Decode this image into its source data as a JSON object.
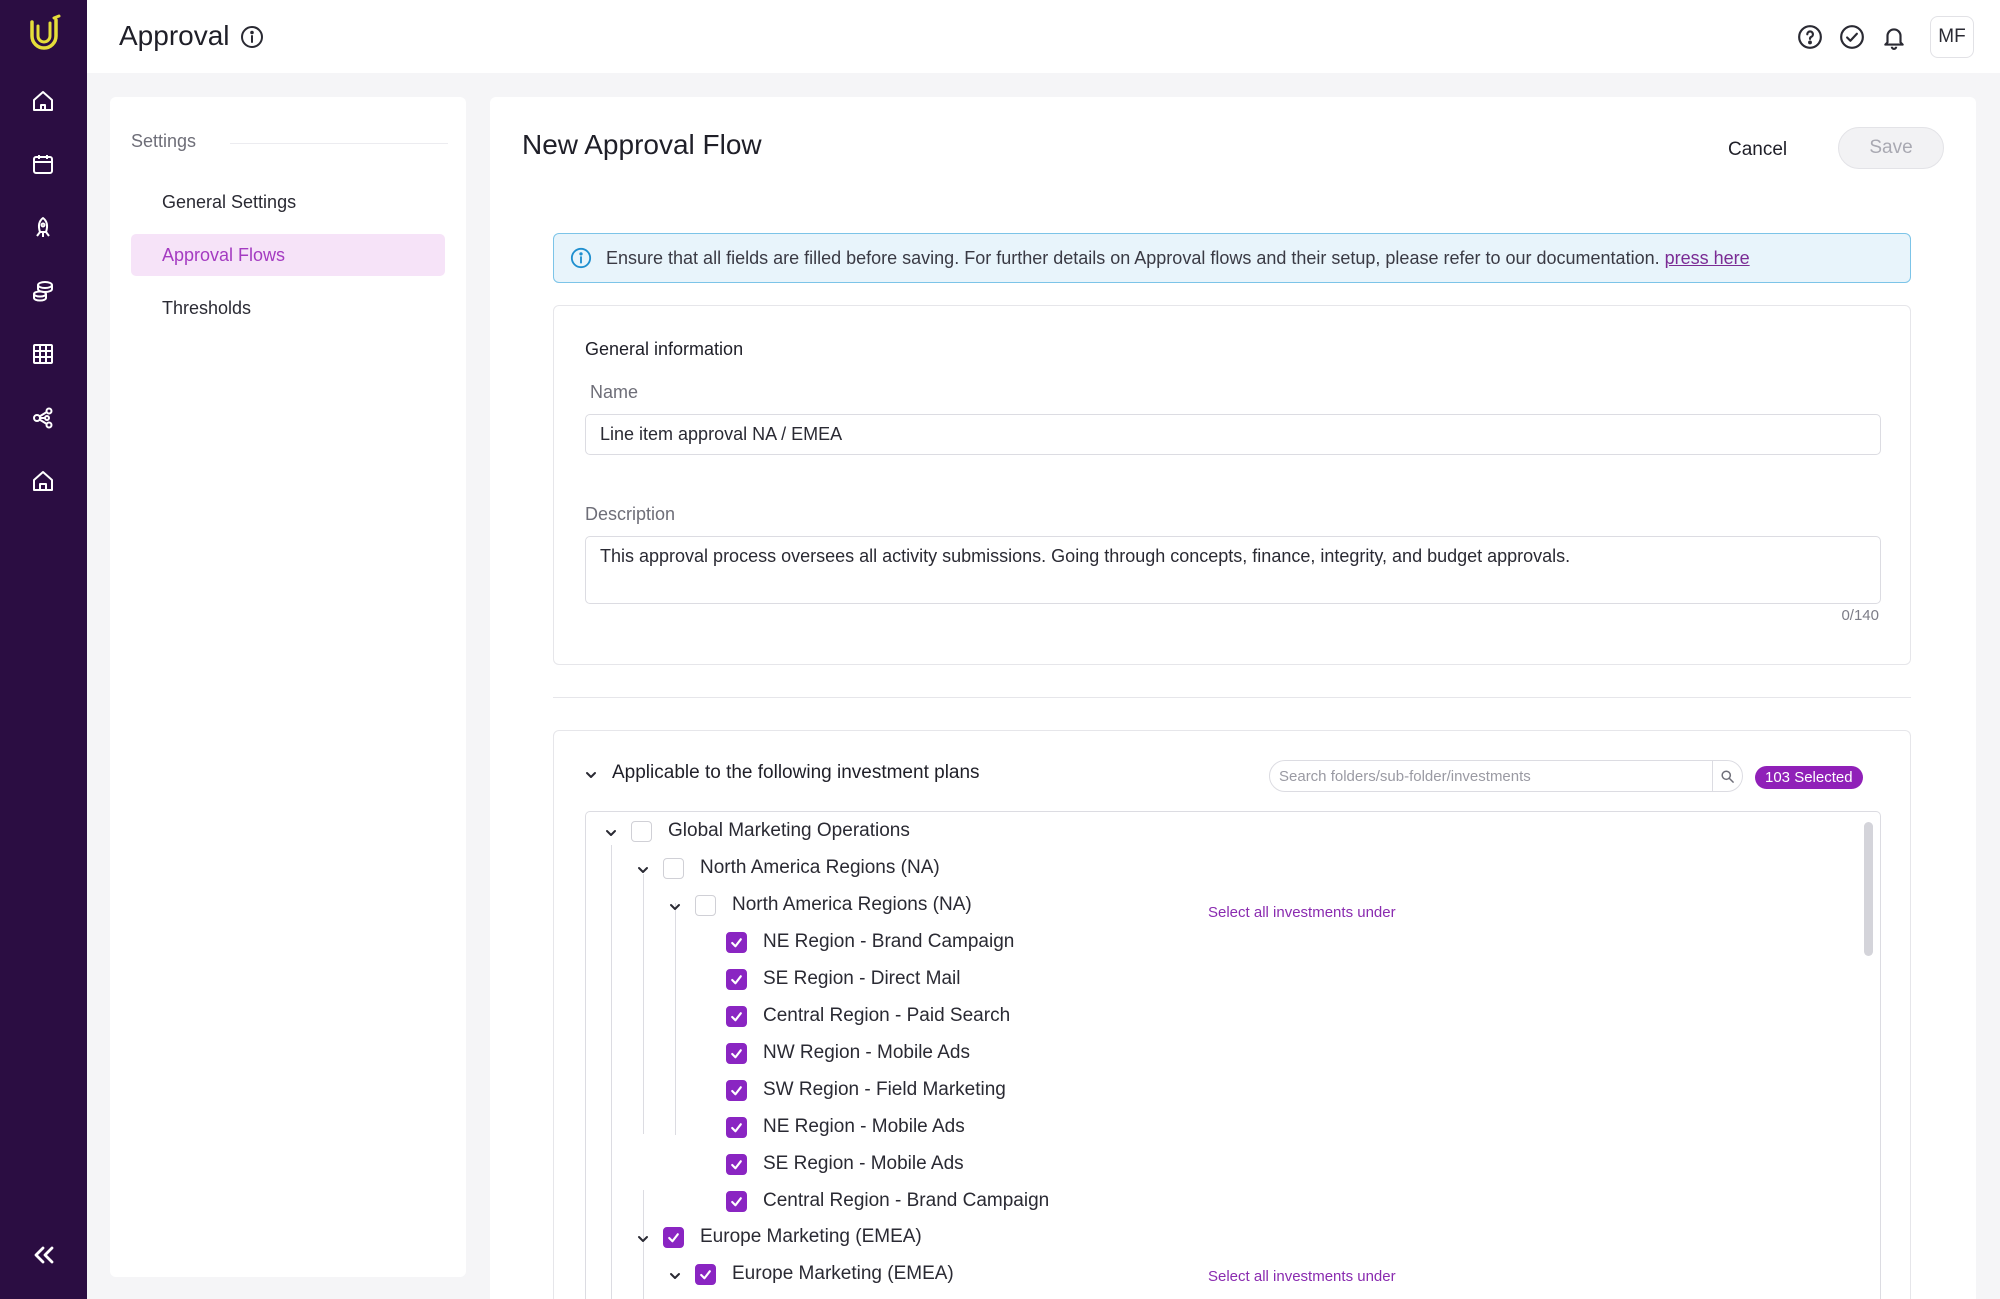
{
  "header": {
    "title": "Approval",
    "avatar_initials": "MF"
  },
  "rail": {
    "items": [
      "home-icon",
      "calendar-icon",
      "rocket-icon",
      "coins-icon",
      "table-icon",
      "share-icon",
      "home-alt-icon"
    ]
  },
  "settings": {
    "section_title": "Settings",
    "items": [
      {
        "label": "General Settings"
      },
      {
        "label": "Approval Flows"
      },
      {
        "label": "Thresholds"
      }
    ]
  },
  "main": {
    "title": "New Approval Flow",
    "cancel_label": "Cancel",
    "save_label": "Save",
    "banner_text": "Ensure that all fields are filled before saving. For further details on Approval flows and their setup, please refer to our documentation.",
    "banner_link": "press here"
  },
  "general": {
    "title": "General information",
    "name_label": "Name",
    "name_value": "Line item approval NA / EMEA",
    "description_label": "Description",
    "description_value": "This approval process oversees all activity submissions. Going through concepts, finance, integrity, and budget approvals.",
    "counter": "0/140"
  },
  "plans": {
    "title": "Applicable to the following investment plans",
    "search_placeholder": "Search folders/sub-folder/investments",
    "selected_badge": "103 Selected",
    "select_all_label": "Select all investments under",
    "tree": [
      {
        "label": "Global Marketing Operations",
        "checked": false
      },
      {
        "label": "North America Regions (NA)",
        "checked": false
      },
      {
        "label": "North America Regions (NA)",
        "checked": false
      },
      {
        "label": "NE Region - Brand Campaign",
        "checked": true
      },
      {
        "label": "SE Region - Direct Mail",
        "checked": true
      },
      {
        "label": "Central Region - Paid Search",
        "checked": true
      },
      {
        "label": "NW Region - Mobile Ads",
        "checked": true
      },
      {
        "label": "SW Region - Field Marketing",
        "checked": true
      },
      {
        "label": "NE Region - Mobile Ads",
        "checked": true
      },
      {
        "label": "SE Region - Mobile Ads",
        "checked": true
      },
      {
        "label": "Central Region - Brand Campaign",
        "checked": true
      },
      {
        "label": "Europe Marketing (EMEA)",
        "checked": true
      },
      {
        "label": "Europe Marketing (EMEA)",
        "checked": true
      }
    ]
  },
  "colors": {
    "rail_bg": "#2b0d42",
    "accent": "#8a25c2",
    "active_item_bg": "#f6e3f8",
    "active_item_text": "#a43bc1",
    "banner_border": "#7cc4e8"
  }
}
